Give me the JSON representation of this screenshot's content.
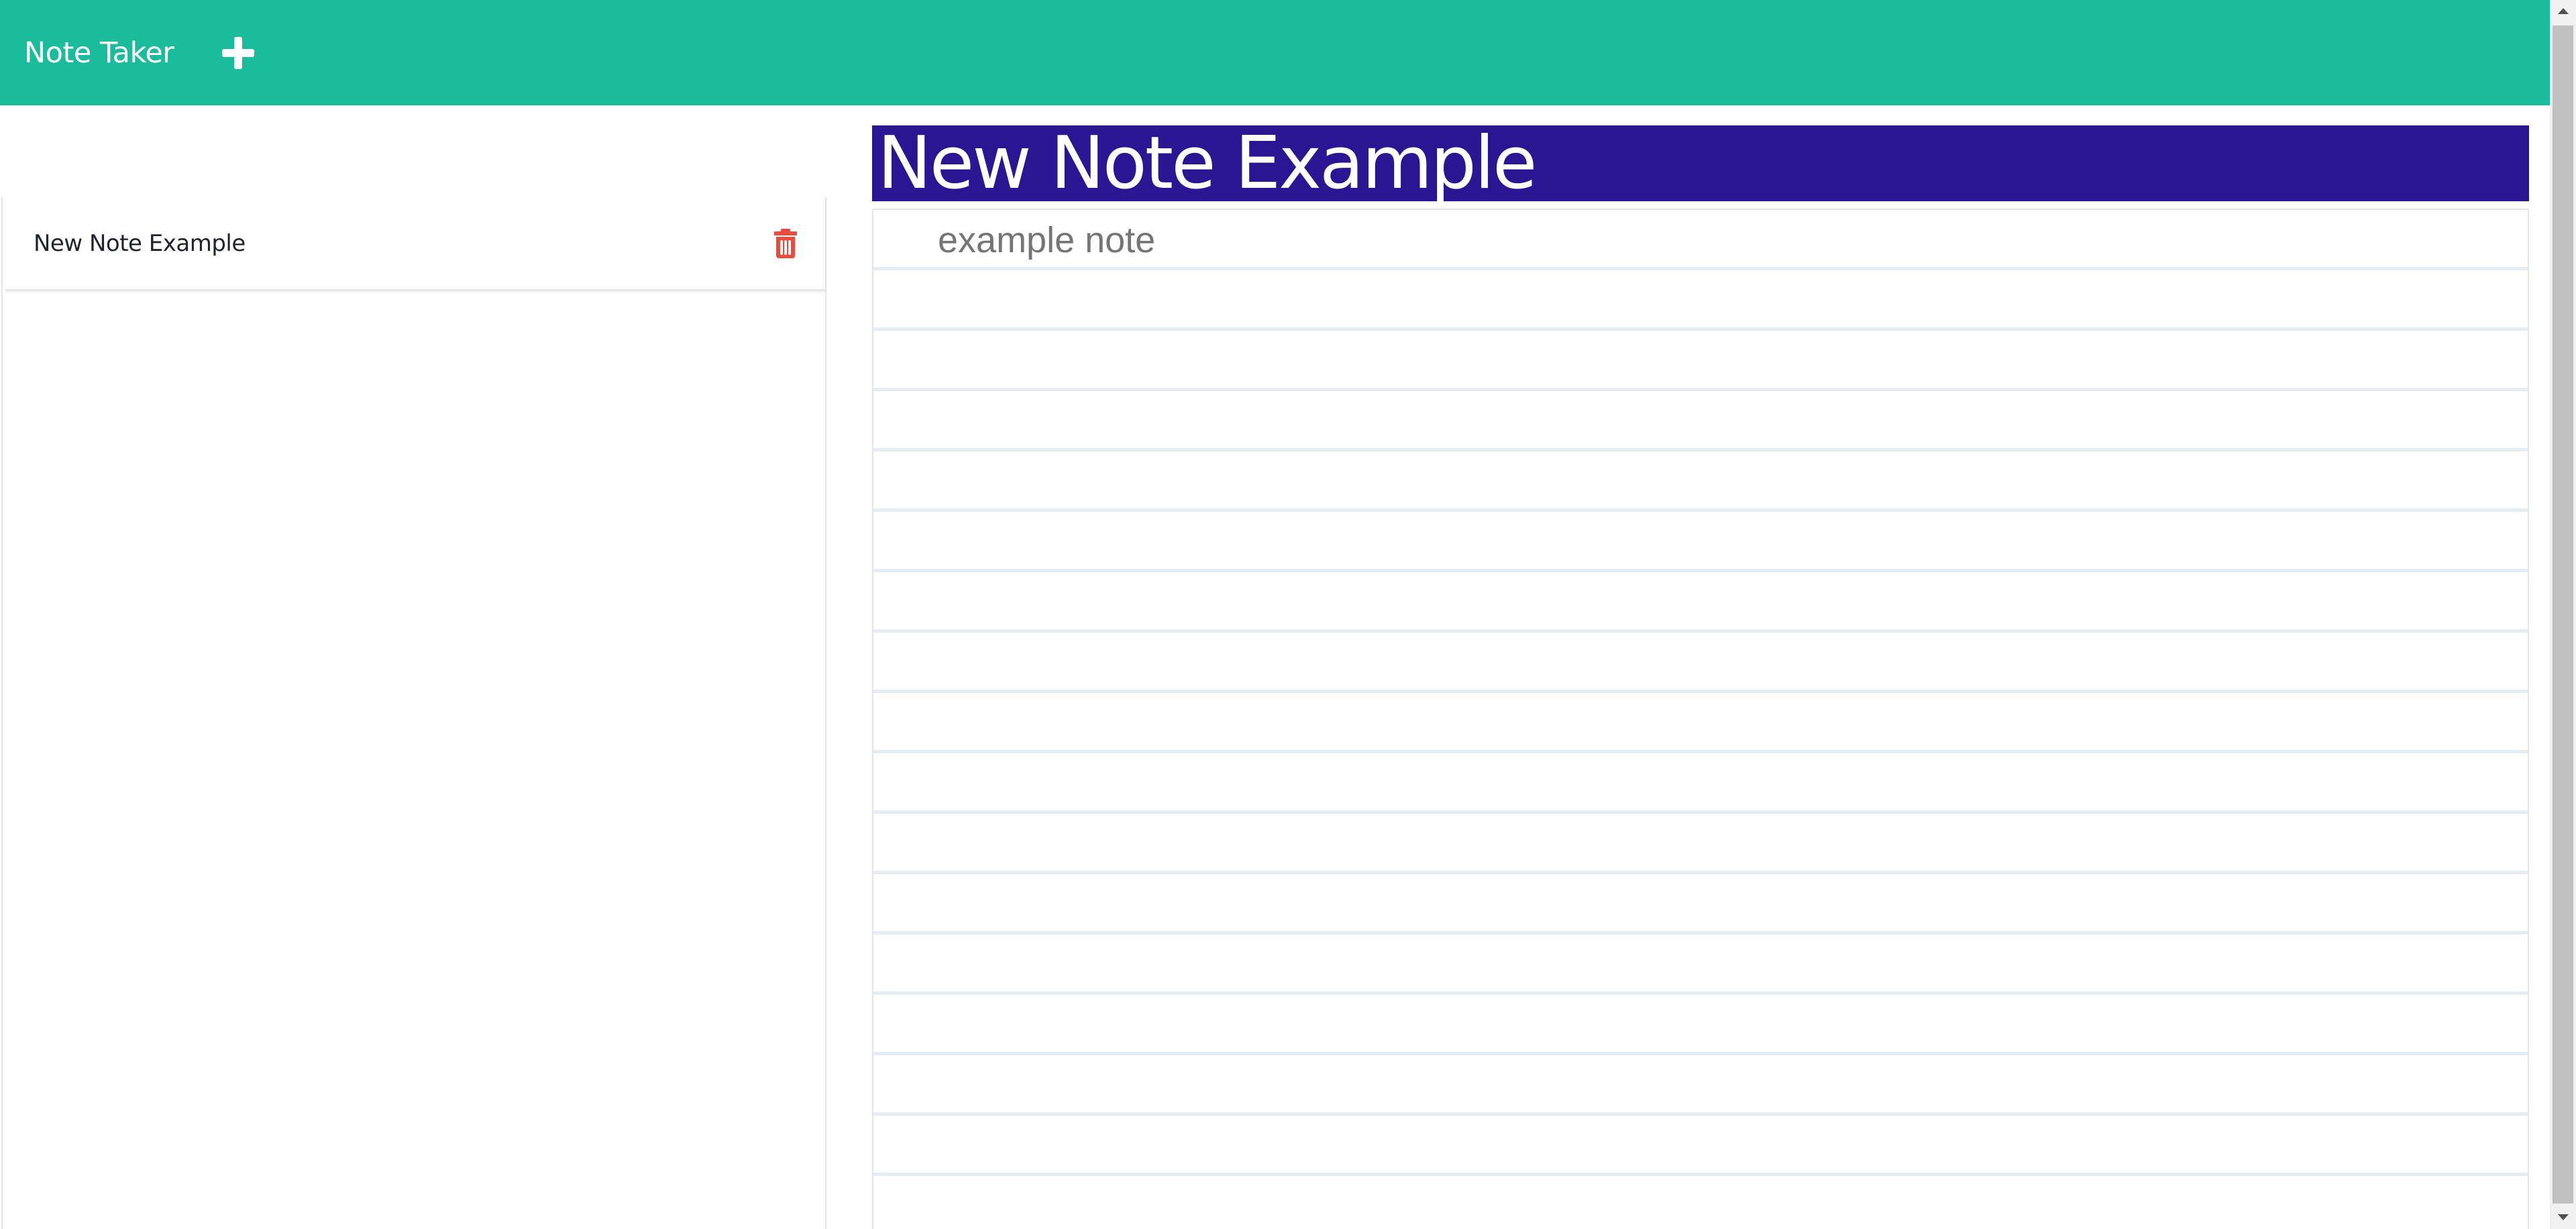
{
  "navbar": {
    "brand": "Note Taker",
    "add_icon": "plus-icon",
    "background_color": "#1abc9c"
  },
  "sidebar": {
    "notes": [
      {
        "title": "New Note Example",
        "delete_icon": "trash-icon"
      }
    ]
  },
  "editor": {
    "title": "New Note Example",
    "text": "example note",
    "title_background_color": "#2a1593"
  },
  "colors": {
    "accent": "#1abc9c",
    "danger": "#e74c3c",
    "title_bg": "#2a1593"
  }
}
